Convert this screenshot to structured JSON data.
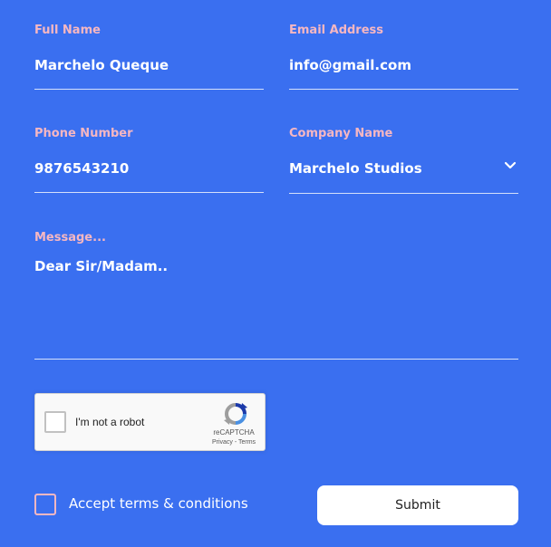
{
  "form": {
    "full_name": {
      "label": "Full Name",
      "value": "Marchelo Queque"
    },
    "email": {
      "label": "Email Address",
      "value": "info@gmail.com"
    },
    "phone": {
      "label": "Phone Number",
      "value": "9876543210"
    },
    "company": {
      "label": "Company Name",
      "value": "Marchelo Studios",
      "icon": "chevron-down-icon"
    },
    "message": {
      "label": "Message...",
      "value": "Dear Sir/Madam.."
    }
  },
  "recaptcha": {
    "label": "I'm not a robot",
    "brand": "reCAPTCHA",
    "privacy": "Privacy",
    "separator": " - ",
    "terms": "Terms",
    "checked": false
  },
  "terms": {
    "label": "Accept terms & conditions",
    "checked": false
  },
  "submit": {
    "label": "Submit"
  },
  "colors": {
    "background": "#3a6ff0",
    "label": "#f6b7c2",
    "text": "#ffffff",
    "underline": "#d5e0fb"
  }
}
